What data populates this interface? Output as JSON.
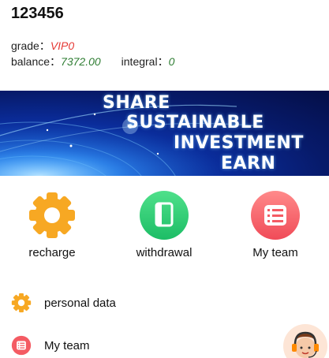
{
  "user": {
    "name": "123456",
    "grade_label": "grade：",
    "grade_value": "VIP0",
    "balance_label": "balance：",
    "balance_value": "7372.00",
    "integral_label": "integral：",
    "integral_value": "0"
  },
  "banner": {
    "lines": [
      "SHARE",
      "SUSTAINABLE",
      "INVESTMENT",
      "EARN"
    ]
  },
  "actions": [
    {
      "label": "recharge",
      "icon": "gear-icon",
      "color": "#f7a823"
    },
    {
      "label": "withdrawal",
      "icon": "book-icon",
      "color": "#2ccf72"
    },
    {
      "label": "My team",
      "icon": "list-icon",
      "color": "#f45b63"
    }
  ],
  "menu": [
    {
      "label": "personal data",
      "icon": "gear-icon",
      "color": "#f7a823"
    },
    {
      "label": "My team",
      "icon": "list-icon",
      "color": "#f45b63"
    }
  ],
  "support": {
    "icon": "customer-service-icon"
  }
}
